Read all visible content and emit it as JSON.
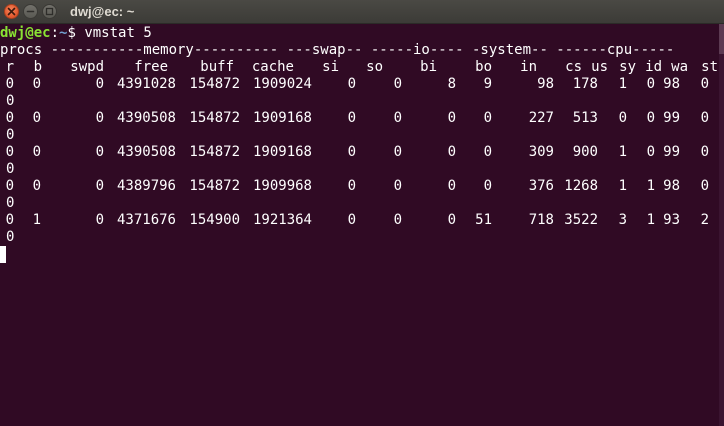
{
  "window": {
    "title": "dwj@ec: ~",
    "buttons": {
      "close": "close-icon",
      "minimize": "minimize-icon",
      "maximize": "maximize-icon"
    }
  },
  "prompt": {
    "user_host": "dwj@ec",
    "colon": ":",
    "path": "~",
    "symbol": "$ ",
    "command": "vmstat 5"
  },
  "vmstat": {
    "group_header": "procs -----------memory---------- ---swap-- -----io---- -system-- ------cpu-----",
    "columns": [
      "r",
      "b",
      "swpd",
      "free",
      "buff",
      "cache",
      "si",
      "so",
      "bi",
      "bo",
      "in",
      "cs",
      "us",
      "sy",
      "id",
      "wa",
      "st"
    ],
    "rows": [
      {
        "values": [
          "0",
          "0",
          "0",
          "4391028",
          "154872",
          "1909024",
          "0",
          "0",
          "8",
          "9",
          "98",
          "178",
          "1",
          "0",
          "98",
          "0",
          "0"
        ]
      },
      {
        "values": [
          "0",
          "0",
          "0",
          "4390508",
          "154872",
          "1909168",
          "0",
          "0",
          "0",
          "0",
          "227",
          "513",
          "0",
          "0",
          "99",
          "0",
          "0"
        ]
      },
      {
        "values": [
          "0",
          "0",
          "0",
          "4390508",
          "154872",
          "1909168",
          "0",
          "0",
          "0",
          "0",
          "309",
          "900",
          "1",
          "0",
          "99",
          "0",
          "0"
        ]
      },
      {
        "values": [
          "0",
          "0",
          "0",
          "4389796",
          "154872",
          "1909968",
          "0",
          "0",
          "0",
          "0",
          "376",
          "1268",
          "1",
          "1",
          "98",
          "0",
          "0"
        ]
      },
      {
        "values": [
          "0",
          "1",
          "0",
          "4371676",
          "154900",
          "1921364",
          "0",
          "0",
          "0",
          "51",
          "718",
          "3522",
          "3",
          "1",
          "93",
          "2",
          "0"
        ]
      }
    ]
  },
  "colors": {
    "background": "#300a24",
    "text": "#ffffff",
    "prompt_user": "#8ae234",
    "prompt_path": "#729fcf",
    "titlebar": "#3c3b37",
    "close_button": "#e0552b"
  }
}
